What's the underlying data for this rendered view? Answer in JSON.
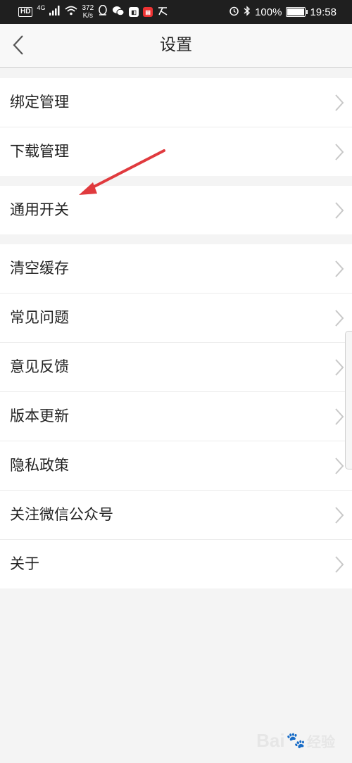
{
  "status_bar": {
    "hd": "HD",
    "signal_gen": "4G",
    "speed": "372",
    "speed_unit": "K/s",
    "battery": "100%",
    "time": "19:58"
  },
  "header": {
    "title": "设置"
  },
  "groups": [
    {
      "items": [
        {
          "label": "绑定管理"
        },
        {
          "label": "下载管理"
        }
      ]
    },
    {
      "items": [
        {
          "label": "通用开关"
        }
      ]
    },
    {
      "items": [
        {
          "label": "清空缓存"
        },
        {
          "label": "常见问题"
        },
        {
          "label": "意见反馈"
        },
        {
          "label": "版本更新"
        },
        {
          "label": "隐私政策"
        },
        {
          "label": "关注微信公众号"
        },
        {
          "label": "关于"
        }
      ]
    }
  ],
  "colors": {
    "annotation_arrow": "#e03a3e",
    "chevron": "#c8c8c8"
  },
  "watermark": {
    "brand": "Bai",
    "paw": "🐾",
    "suffix": "经验"
  }
}
